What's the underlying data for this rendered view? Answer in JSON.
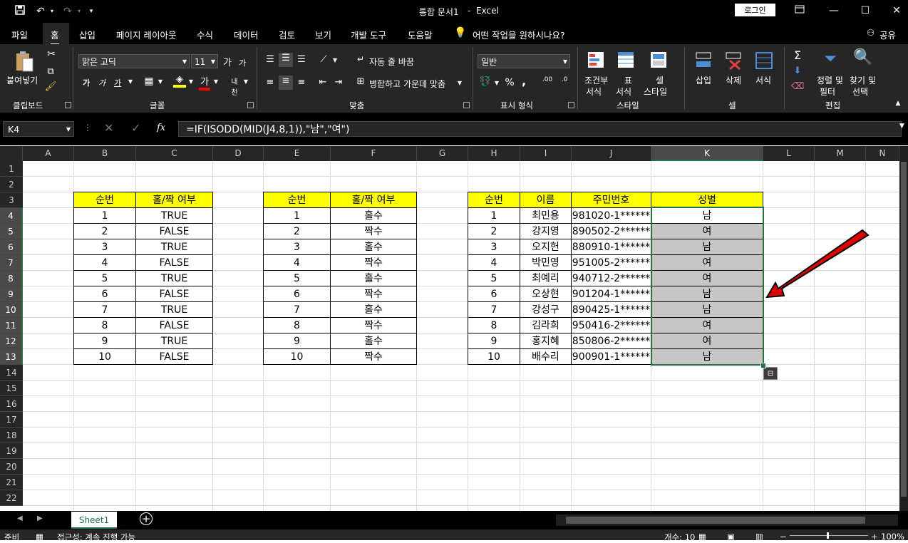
{
  "title": {
    "doc": "통합 문서1",
    "sep": "-",
    "app": "Excel",
    "login": "로그인"
  },
  "tabs": [
    "파일",
    "홈",
    "삽입",
    "페이지 레이아웃",
    "수식",
    "데이터",
    "검토",
    "보기",
    "개발 도구",
    "도움말"
  ],
  "tell_me": "어떤 작업을 원하시나요?",
  "share": "공유",
  "ribbon": {
    "paste": "붙여넣기",
    "clipboard": "클립보드",
    "font_name": "맑은 고딕",
    "font_size": "11",
    "font_group": "글꼴",
    "wrap_text": "자동 줄 바꿈",
    "merge_center": "병합하고 가운데 맞춤",
    "align_group": "맞춤",
    "number_format": "일반",
    "number_group": "표시 형식",
    "percent": "%",
    "comma": ",",
    "cond_format_1": "조건부",
    "cond_format_2": "서식",
    "table_1": "표",
    "table_2": "서식",
    "cell_style_1": "셀",
    "cell_style_2": "스타일",
    "style_group": "스타일",
    "insert": "삽입",
    "delete": "삭제",
    "format": "서식",
    "cells_group": "셀",
    "sort_1": "정렬 및",
    "sort_2": "필터",
    "find_1": "찾기 및",
    "find_2": "선택",
    "edit_group": "편집"
  },
  "namebox": "K4",
  "formula": "=IF(ISODD(MID(J4,8,1)),\"남\",\"여\")",
  "columns": [
    "A",
    "B",
    "C",
    "D",
    "E",
    "F",
    "G",
    "H",
    "I",
    "J",
    "K",
    "L",
    "M",
    "N"
  ],
  "rows": [
    "1",
    "2",
    "3",
    "4",
    "5",
    "6",
    "7",
    "8",
    "9",
    "10",
    "11",
    "12",
    "13",
    "14",
    "15",
    "16",
    "17",
    "18",
    "19",
    "20",
    "21",
    "22"
  ],
  "table1": {
    "headers": [
      "순번",
      "홀/짝 여부"
    ],
    "rows": [
      [
        "1",
        "TRUE"
      ],
      [
        "2",
        "FALSE"
      ],
      [
        "3",
        "TRUE"
      ],
      [
        "4",
        "FALSE"
      ],
      [
        "5",
        "TRUE"
      ],
      [
        "6",
        "FALSE"
      ],
      [
        "7",
        "TRUE"
      ],
      [
        "8",
        "FALSE"
      ],
      [
        "9",
        "TRUE"
      ],
      [
        "10",
        "FALSE"
      ]
    ]
  },
  "table2": {
    "headers": [
      "순번",
      "홀/짝 여부"
    ],
    "rows": [
      [
        "1",
        "홀수"
      ],
      [
        "2",
        "짝수"
      ],
      [
        "3",
        "홀수"
      ],
      [
        "4",
        "짝수"
      ],
      [
        "5",
        "홀수"
      ],
      [
        "6",
        "짝수"
      ],
      [
        "7",
        "홀수"
      ],
      [
        "8",
        "짝수"
      ],
      [
        "9",
        "홀수"
      ],
      [
        "10",
        "짝수"
      ]
    ]
  },
  "table3": {
    "headers": [
      "순번",
      "이름",
      "주민번호",
      "성별"
    ],
    "rows": [
      [
        "1",
        "최민용",
        "981020-1******",
        "남"
      ],
      [
        "2",
        "강지영",
        "890502-2******",
        "여"
      ],
      [
        "3",
        "오지헌",
        "880910-1******",
        "남"
      ],
      [
        "4",
        "박민영",
        "951005-2******",
        "여"
      ],
      [
        "5",
        "최예리",
        "940712-2******",
        "여"
      ],
      [
        "6",
        "오상현",
        "901204-1******",
        "남"
      ],
      [
        "7",
        "강성구",
        "890425-1******",
        "남"
      ],
      [
        "8",
        "김라희",
        "950416-2******",
        "여"
      ],
      [
        "9",
        "홍지혜",
        "850806-2******",
        "여"
      ],
      [
        "10",
        "배수리",
        "900901-1******",
        "남"
      ]
    ]
  },
  "sheet_tab": "Sheet1",
  "status": {
    "ready": "준비",
    "accessibility": "접근성: 계속 진행 가능",
    "count": "개수: 10",
    "zoom": "100%"
  },
  "colors": {
    "header_fill": "#ffff00",
    "selected_fill": "#c6c6c6",
    "arrow": "#e00000",
    "accent": "#217346"
  }
}
